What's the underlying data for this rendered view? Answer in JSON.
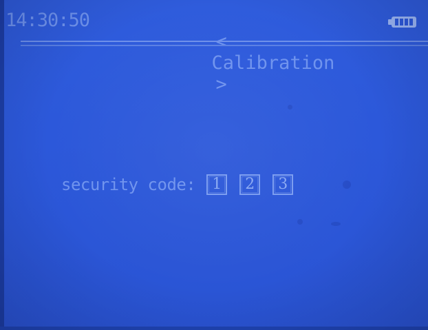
{
  "status_bar": {
    "time": "14:30:50",
    "title": "Calibration",
    "prev_arrow": "<",
    "next_arrow": ">",
    "battery_icon": "battery-full-icon"
  },
  "main": {
    "prompt_label": "security code:",
    "digits": [
      "1",
      "2",
      "3"
    ]
  },
  "colors": {
    "background": "#2c58da",
    "text": "#6f93ee",
    "digit_box": "#7a9cf0"
  }
}
